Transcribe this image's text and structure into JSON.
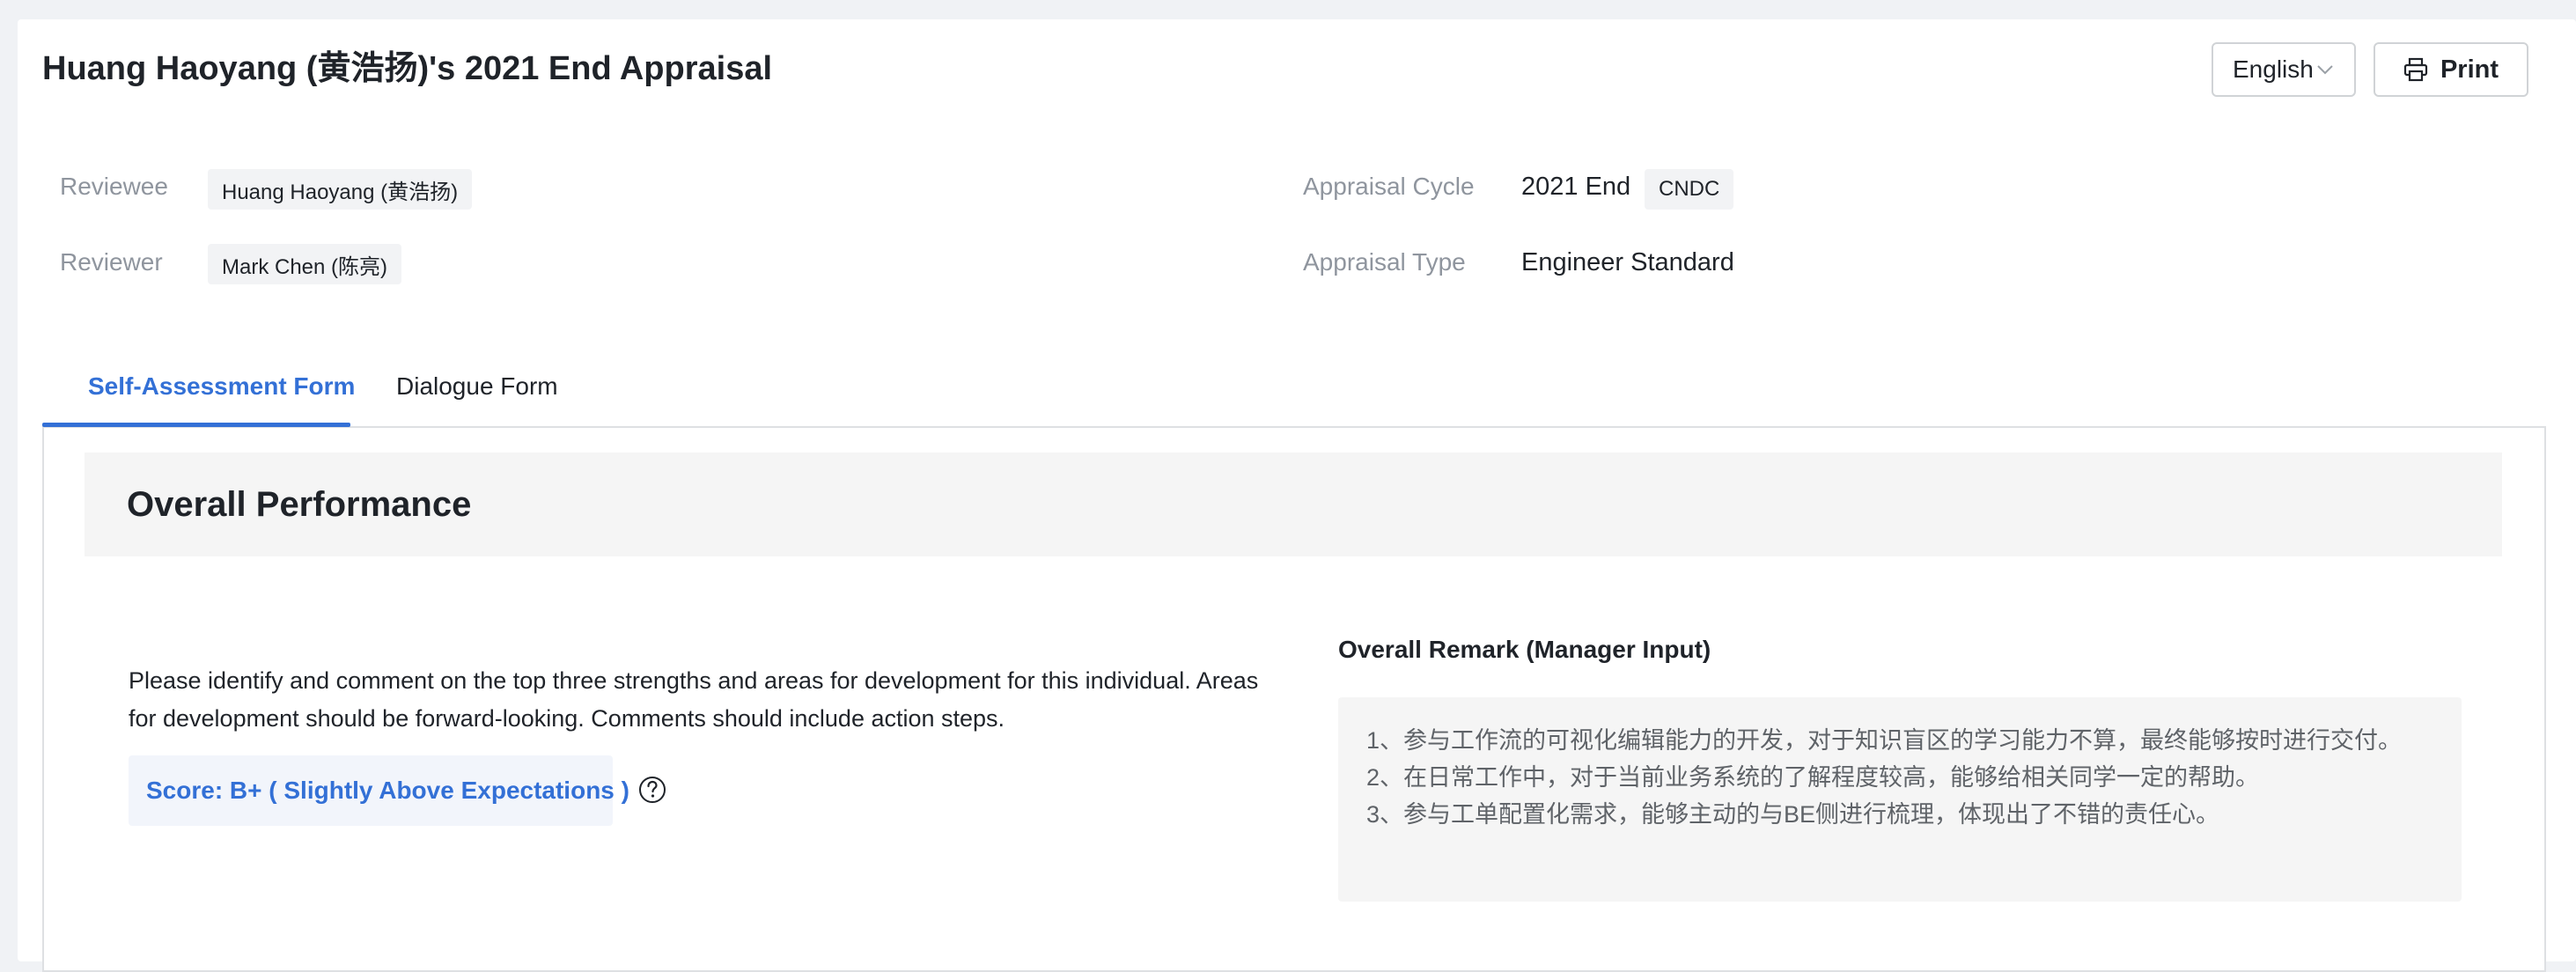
{
  "header": {
    "title": "Huang Haoyang (黄浩扬)'s 2021 End Appraisal",
    "language": "English",
    "print_label": "Print"
  },
  "meta": {
    "reviewee_label": "Reviewee",
    "reviewee": "Huang Haoyang (黄浩扬)",
    "reviewer_label": "Reviewer",
    "reviewer": "Mark Chen (陈亮)",
    "cycle_label": "Appraisal Cycle",
    "cycle": "2021 End",
    "cycle_tag": "CNDC",
    "type_label": "Appraisal Type",
    "type": "Engineer Standard"
  },
  "tabs": [
    {
      "label": "Self-Assessment Form",
      "active": true
    },
    {
      "label": "Dialogue Form",
      "active": false
    }
  ],
  "section": {
    "title": "Overall Performance",
    "instructions": "Please identify and comment on the top three strengths and areas for development for this individual. Areas for development should be forward-looking. Comments should include action steps.",
    "score": "Score: B+ ( Slightly Above Expectations )",
    "remark_label": "Overall Remark (Manager Input)",
    "remark_lines": [
      "1、参与工作流的可视化编辑能力的开发，对于知识盲区的学习能力不算，最终能够按时进行交付。",
      "2、在日常工作中，对于当前业务系统的了解程度较高，能够给相关同学一定的帮助。",
      "3、参与工单配置化需求，能够主动的与BE侧进行梳理，体现出了不错的责任心。"
    ]
  },
  "colors": {
    "accent": "#3370d6",
    "label_gray": "#8f959e",
    "background": "#f0f2f5"
  },
  "icons": {
    "language_dropdown": "chevron-down-icon",
    "print": "printer-icon",
    "help": "question-circle-icon"
  }
}
